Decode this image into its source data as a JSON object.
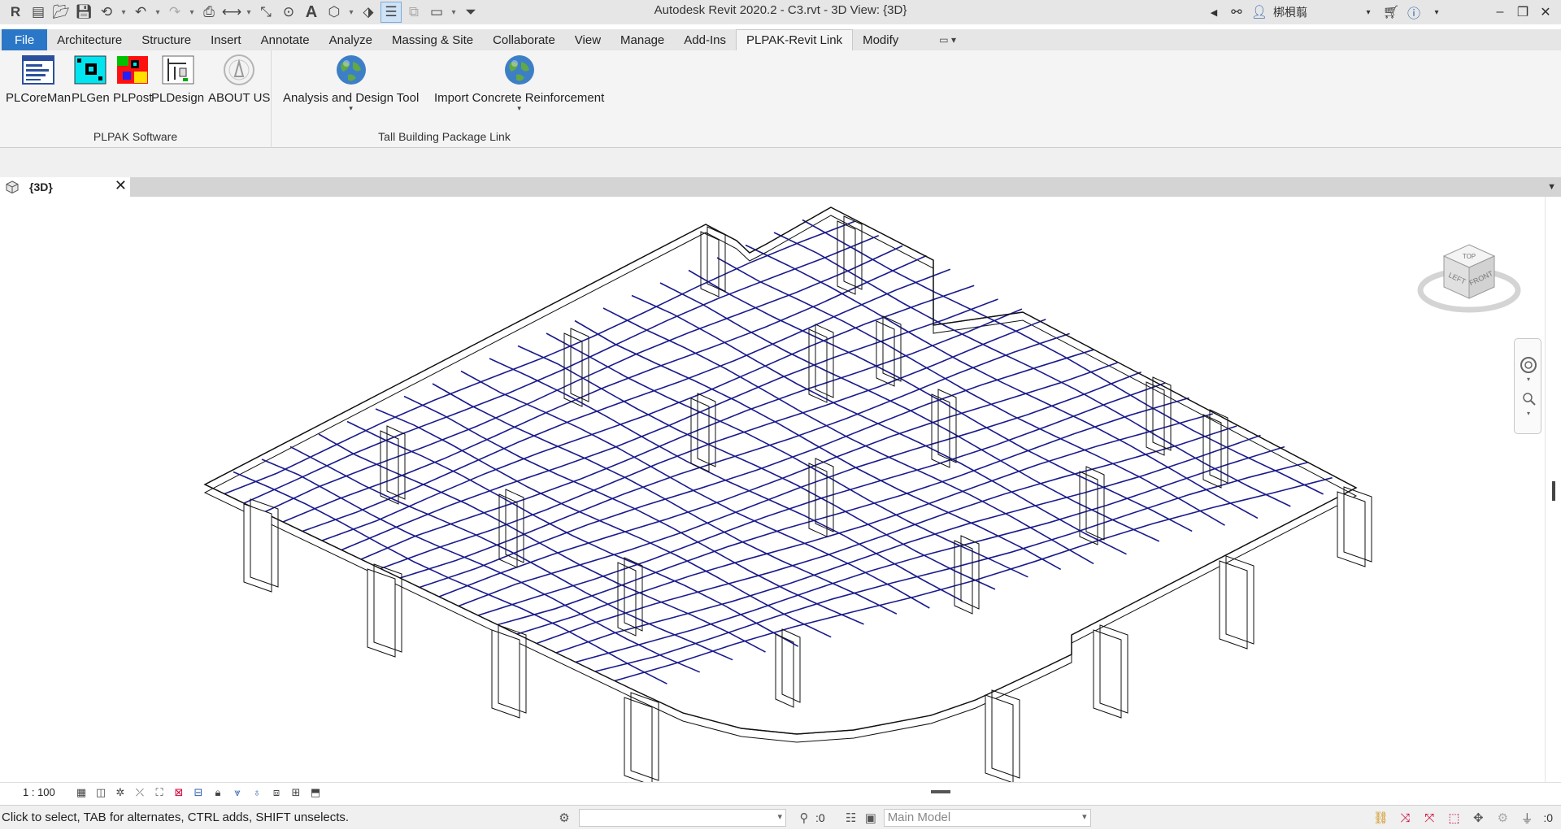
{
  "window": {
    "title": "Autodesk Revit 2020.2 - C3.rvt - 3D View: {3D}",
    "user_name": "梆梖翦",
    "logo": "R"
  },
  "quick_access": {
    "icons": [
      "open-icon",
      "save-icon",
      "sync-icon",
      "undo-icon",
      "redo-icon",
      "print-icon",
      "measure-icon",
      "dimension-icon",
      "tag-icon",
      "text-icon",
      "3d-view-icon",
      "section-icon",
      "thin-lines-icon",
      "close-hidden-icon",
      "switch-windows-icon",
      "customize-icon"
    ]
  },
  "ribbon_tabs": [
    "File",
    "Architecture",
    "Structure",
    "Insert",
    "Annotate",
    "Analyze",
    "Massing & Site",
    "Collaborate",
    "View",
    "Manage",
    "Add-Ins",
    "PLPAK-Revit Link",
    "Modify"
  ],
  "active_tab": "PLPAK-Revit Link",
  "panels": {
    "plpak_software": {
      "title": "PLPAK Software",
      "buttons": [
        "PLCoreMan",
        "PLGen",
        "PLPost",
        "PLDesign",
        "ABOUT US"
      ]
    },
    "tall_building": {
      "title": "Tall Building Package Link",
      "buttons": [
        "Analysis and Design Tool",
        "Import Concrete Reinforcement"
      ]
    }
  },
  "view_tab": {
    "name": "{3D}"
  },
  "viewcube": {
    "faces": [
      "TOP",
      "LEFT",
      "FRONT"
    ]
  },
  "view_control": {
    "scale": "1 : 100"
  },
  "status": {
    "message": "Click to select, TAB for alternates, CTRL adds, SHIFT unselects.",
    "workset_value": "",
    "editable_count": ":0",
    "design_option": "Main Model",
    "filter_count": ":0"
  },
  "colors": {
    "file_tab": "#2b77c7",
    "mesh": "#1a1a8c",
    "outline": "#111111",
    "ribbon_bg": "#f4f4f4"
  }
}
